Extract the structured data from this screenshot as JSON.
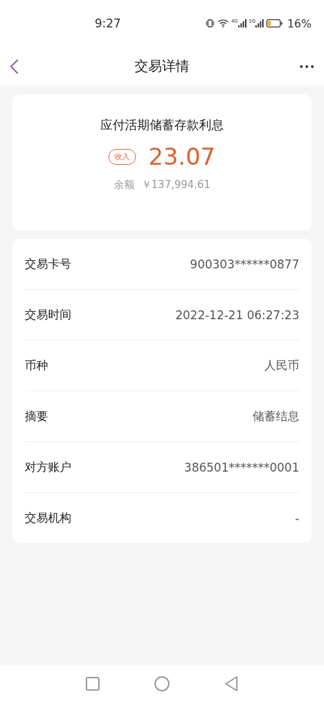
{
  "status_bar": {
    "time": "9:27",
    "network_1": "4G",
    "network_2": "5G",
    "battery": "16%"
  },
  "header": {
    "title": "交易详情"
  },
  "summary": {
    "title": "应付活期储蓄存款利息",
    "tag": "收入",
    "amount": "23.07",
    "balance_label": "余额",
    "balance": "￥137,994.61"
  },
  "details": [
    {
      "label": "交易卡号",
      "value": "900303******0877"
    },
    {
      "label": "交易时间",
      "value": "2022-12-21 06:27:23"
    },
    {
      "label": "币种",
      "value": "人民币"
    },
    {
      "label": "摘要",
      "value": "储蓄结息"
    },
    {
      "label": "对方账户",
      "value": "386501*******0001"
    },
    {
      "label": "交易机构",
      "value": "-"
    }
  ]
}
